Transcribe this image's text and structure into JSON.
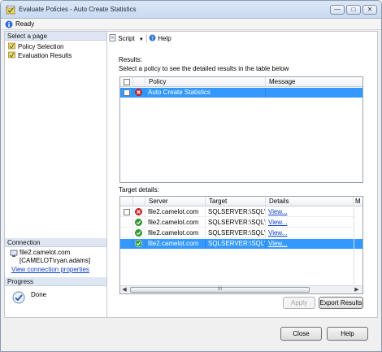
{
  "window": {
    "title": "Evaluate Policies - Auto Create Statistics",
    "status": "Ready"
  },
  "left": {
    "select_page_title": "Select a page",
    "pages": [
      {
        "label": "Policy Selection"
      },
      {
        "label": "Evaluation Results"
      }
    ],
    "connection_title": "Connection",
    "connection_server": "file2.camelot.com",
    "connection_user": "[CAMELOT\\ryan.adams]",
    "connection_link": "View connection properties",
    "progress_title": "Progress",
    "progress_status": "Done"
  },
  "toolbar": {
    "script_label": "Script",
    "help_label": "Help"
  },
  "results": {
    "label": "Results:",
    "instruction": "Select a policy to see the detailed results in the table below",
    "columns": {
      "policy": "Policy",
      "message": "Message"
    },
    "rows": [
      {
        "policy": "Auto Create Statistics",
        "message": "",
        "status": "error",
        "selected": true
      }
    ]
  },
  "target": {
    "label": "Target details:",
    "columns": {
      "server": "Server",
      "target": "Target",
      "details": "Details",
      "more": "M"
    },
    "rows": [
      {
        "server": "file2.camelot.com",
        "target": "SQLSERVER:\\SQL\\F...",
        "details": "View...",
        "status": "error",
        "checkbox": true,
        "selected": false
      },
      {
        "server": "file2.camelot.com",
        "target": "SQLSERVER:\\SQL\\F...",
        "details": "View...",
        "status": "success",
        "checkbox": false,
        "selected": false
      },
      {
        "server": "file2.camelot.com",
        "target": "SQLSERVER:\\SQL\\F...",
        "details": "View...",
        "status": "success",
        "checkbox": false,
        "selected": false
      },
      {
        "server": "file2.camelot.com",
        "target": "SQLSERVER:\\SQL\\F...",
        "details": "View...",
        "status": "success",
        "checkbox": false,
        "selected": true
      }
    ],
    "scroll_thumb_grip": "III"
  },
  "buttons": {
    "apply": "Apply",
    "export": "Export Results",
    "close": "Close",
    "help": "Help"
  },
  "colors": {
    "selection": "#3399ff",
    "link": "#0b3fc7",
    "error": "#d62828",
    "success": "#2f9e2f"
  }
}
